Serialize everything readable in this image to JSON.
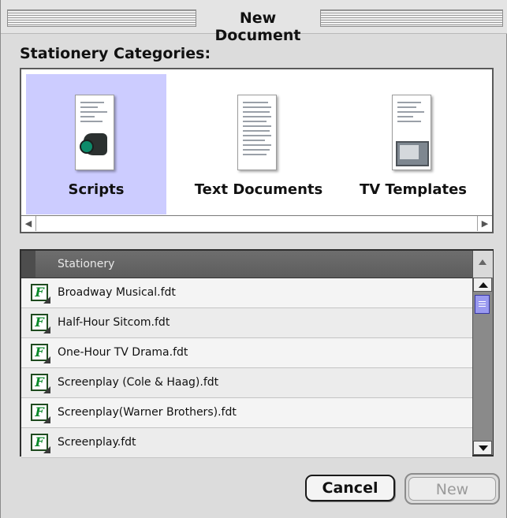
{
  "window": {
    "title": "New Document"
  },
  "categories_section": {
    "label": "Stationery Categories:",
    "items": [
      {
        "label": "Scripts",
        "icon": "script-document-camera-icon",
        "selected": true
      },
      {
        "label": "Text Documents",
        "icon": "text-document-icon",
        "selected": false
      },
      {
        "label": "TV Templates",
        "icon": "tv-document-icon",
        "selected": false
      }
    ],
    "selection_color": "#ccccff"
  },
  "stationery_list": {
    "column_header": "Stationery",
    "files": [
      {
        "name": "Broadway Musical.fdt",
        "icon": "final-draft-file-icon"
      },
      {
        "name": "Half-Hour Sitcom.fdt",
        "icon": "final-draft-file-icon"
      },
      {
        "name": "One-Hour TV Drama.fdt",
        "icon": "final-draft-file-icon"
      },
      {
        "name": "Screenplay (Cole & Haag).fdt",
        "icon": "final-draft-file-icon"
      },
      {
        "name": "Screenplay(Warner Brothers).fdt",
        "icon": "final-draft-file-icon"
      },
      {
        "name": "Screenplay.fdt",
        "icon": "final-draft-file-icon"
      }
    ]
  },
  "buttons": {
    "cancel": "Cancel",
    "new": "New"
  }
}
